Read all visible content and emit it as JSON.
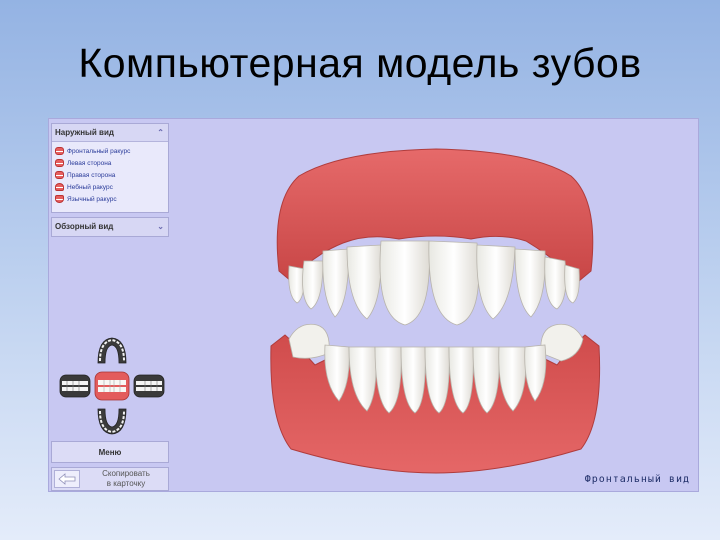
{
  "slide": {
    "title": "Компьютерная модель зубов"
  },
  "sidebar": {
    "outer_view": {
      "title": "Наружный вид",
      "items": [
        {
          "label": "Фронтальный ракурс"
        },
        {
          "label": "Левая сторона"
        },
        {
          "label": "Правая сторона"
        },
        {
          "label": "Небный ракурс"
        },
        {
          "label": "Язычный ракурс"
        }
      ]
    },
    "overview": {
      "title": "Обзорный вид"
    },
    "menu_label": "Меню",
    "copy_label_line1": "Скопировать",
    "copy_label_line2": "в карточку"
  },
  "viewport": {
    "caption": "Фронтальный вид"
  },
  "colors": {
    "gum": "#e05a5a",
    "tooth": "#f7f7f2",
    "background": "#c8c8f2"
  }
}
